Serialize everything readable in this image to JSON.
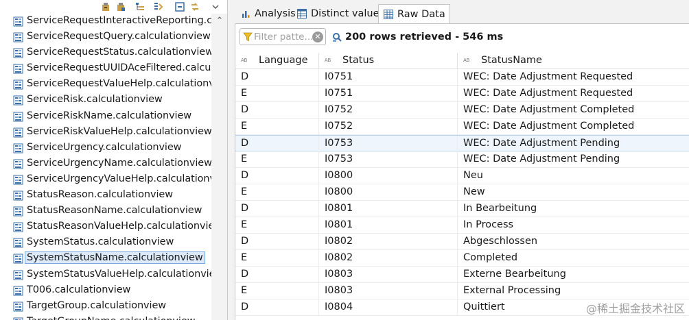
{
  "left_tree": {
    "items": [
      {
        "label": "ServiceRequestInteractiveReporting.calcul",
        "selected": false,
        "icon": "calcview-icon"
      },
      {
        "label": "ServiceRequestQuery.calculationview",
        "selected": false,
        "icon": "calcview-icon"
      },
      {
        "label": "ServiceRequestStatus.calculationview",
        "selected": false,
        "icon": "calcview-icon"
      },
      {
        "label": "ServiceRequestUUIDAceFiltered.calculati",
        "selected": false,
        "icon": "calcview-icon"
      },
      {
        "label": "ServiceRequestValueHelp.calculationview",
        "selected": false,
        "icon": "calcview-icon"
      },
      {
        "label": "ServiceRisk.calculationview",
        "selected": false,
        "icon": "calcview-icon"
      },
      {
        "label": "ServiceRiskName.calculationview",
        "selected": false,
        "icon": "calcview-icon"
      },
      {
        "label": "ServiceRiskValueHelp.calculationview",
        "selected": false,
        "icon": "calcview-icon"
      },
      {
        "label": "ServiceUrgency.calculationview",
        "selected": false,
        "icon": "calcview-icon"
      },
      {
        "label": "ServiceUrgencyName.calculationview",
        "selected": false,
        "icon": "calcview-icon"
      },
      {
        "label": "ServiceUrgencyValueHelp.calculationview",
        "selected": false,
        "icon": "calcview-icon"
      },
      {
        "label": "StatusReason.calculationview",
        "selected": false,
        "icon": "calcview-icon"
      },
      {
        "label": "StatusReasonName.calculationview",
        "selected": false,
        "icon": "calcview-icon"
      },
      {
        "label": "StatusReasonValueHelp.calculationview",
        "selected": false,
        "icon": "calcview-icon"
      },
      {
        "label": "SystemStatus.calculationview",
        "selected": false,
        "icon": "calcview-icon"
      },
      {
        "label": "SystemStatusName.calculationview",
        "selected": true,
        "icon": "calcview-icon"
      },
      {
        "label": "SystemStatusValueHelp.calculationview",
        "selected": false,
        "icon": "calcview-icon"
      },
      {
        "label": "T006.calculationview",
        "selected": false,
        "icon": "calcview-icon"
      },
      {
        "label": "TargetGroup.calculationview",
        "selected": false,
        "icon": "calcview-icon"
      },
      {
        "label": "TargetGroupName.calculationview",
        "selected": false,
        "icon": "calcview-icon"
      }
    ]
  },
  "tabs": [
    {
      "label": "Analysis",
      "icon": "bar-chart-icon",
      "active": false
    },
    {
      "label": "Distinct values",
      "icon": "distinct-table-icon",
      "active": false
    },
    {
      "label": "Raw Data",
      "icon": "grid-table-icon",
      "active": true
    }
  ],
  "filter": {
    "placeholder": "Filter patte...",
    "value": ""
  },
  "status": {
    "text": "200 rows retrieved - 546 ms"
  },
  "table": {
    "columns": [
      "Language",
      "Status",
      "StatusName"
    ],
    "column_type_tag": "AB",
    "rows": [
      [
        "D",
        "I0751",
        "WEC: Date Adjustment Requested"
      ],
      [
        "E",
        "I0751",
        "WEC: Date Adjustment Requested"
      ],
      [
        "D",
        "I0752",
        "WEC: Date Adjustment Completed"
      ],
      [
        "E",
        "I0752",
        "WEC: Date Adjustment Completed"
      ],
      [
        "D",
        "I0753",
        "WEC: Date Adjustment Pending"
      ],
      [
        "E",
        "I0753",
        "WEC: Date Adjustment Pending"
      ],
      [
        "D",
        "I0800",
        "Neu"
      ],
      [
        "E",
        "I0800",
        "New"
      ],
      [
        "D",
        "I0801",
        "In Bearbeitung"
      ],
      [
        "E",
        "I0801",
        "In Process"
      ],
      [
        "D",
        "I0802",
        "Abgeschlossen"
      ],
      [
        "E",
        "I0802",
        "Completed"
      ],
      [
        "D",
        "I0803",
        "Externe Bearbeitung"
      ],
      [
        "E",
        "I0803",
        "External Processing"
      ],
      [
        "D",
        "I0804",
        "Quittiert"
      ]
    ],
    "highlighted_row": 4
  },
  "watermark": "@稀土掘金技术社区",
  "colors": {
    "selection_bg": "#dce9f8",
    "row_highlight": "#eef5fc",
    "tab_bar_bg": "#f2f2f2",
    "icon_blue": "#3a6ea5"
  }
}
